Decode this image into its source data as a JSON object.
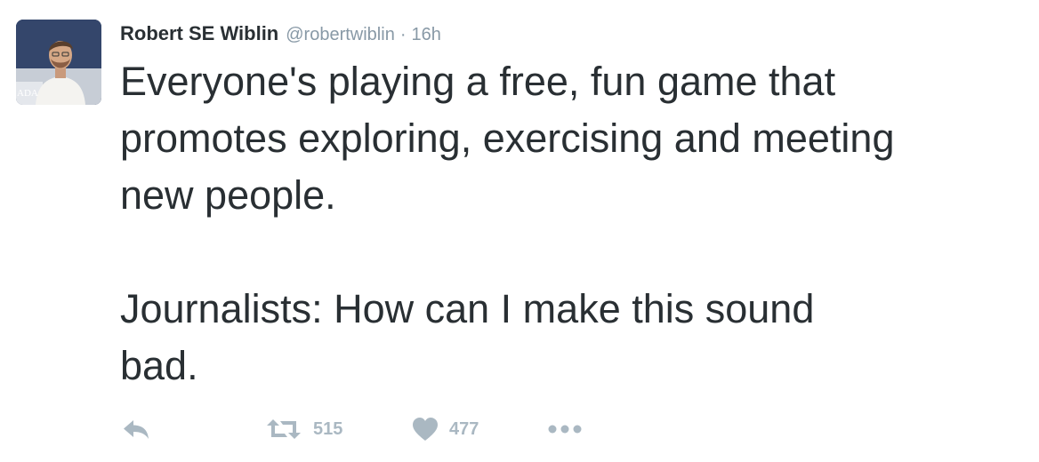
{
  "tweet": {
    "author": {
      "name": "Robert SE Wiblin",
      "handle": "@robertwiblin",
      "avatar_icon": "profile-photo"
    },
    "separator": "·",
    "timestamp": "16h",
    "paragraphs": [
      "Everyone's playing a free, fun game that\npromotes exploring, exercising and meeting\nnew people.",
      "Journalists: How can I make this sound\nbad."
    ],
    "actions": {
      "reply": {
        "icon": "reply-icon"
      },
      "retweet": {
        "icon": "retweet-icon",
        "count": "515"
      },
      "like": {
        "icon": "heart-icon",
        "count": "477"
      },
      "more": {
        "icon": "more-icon"
      }
    }
  },
  "colors": {
    "text": "#292f33",
    "muted": "#8899a6",
    "action": "#aab8c2"
  }
}
